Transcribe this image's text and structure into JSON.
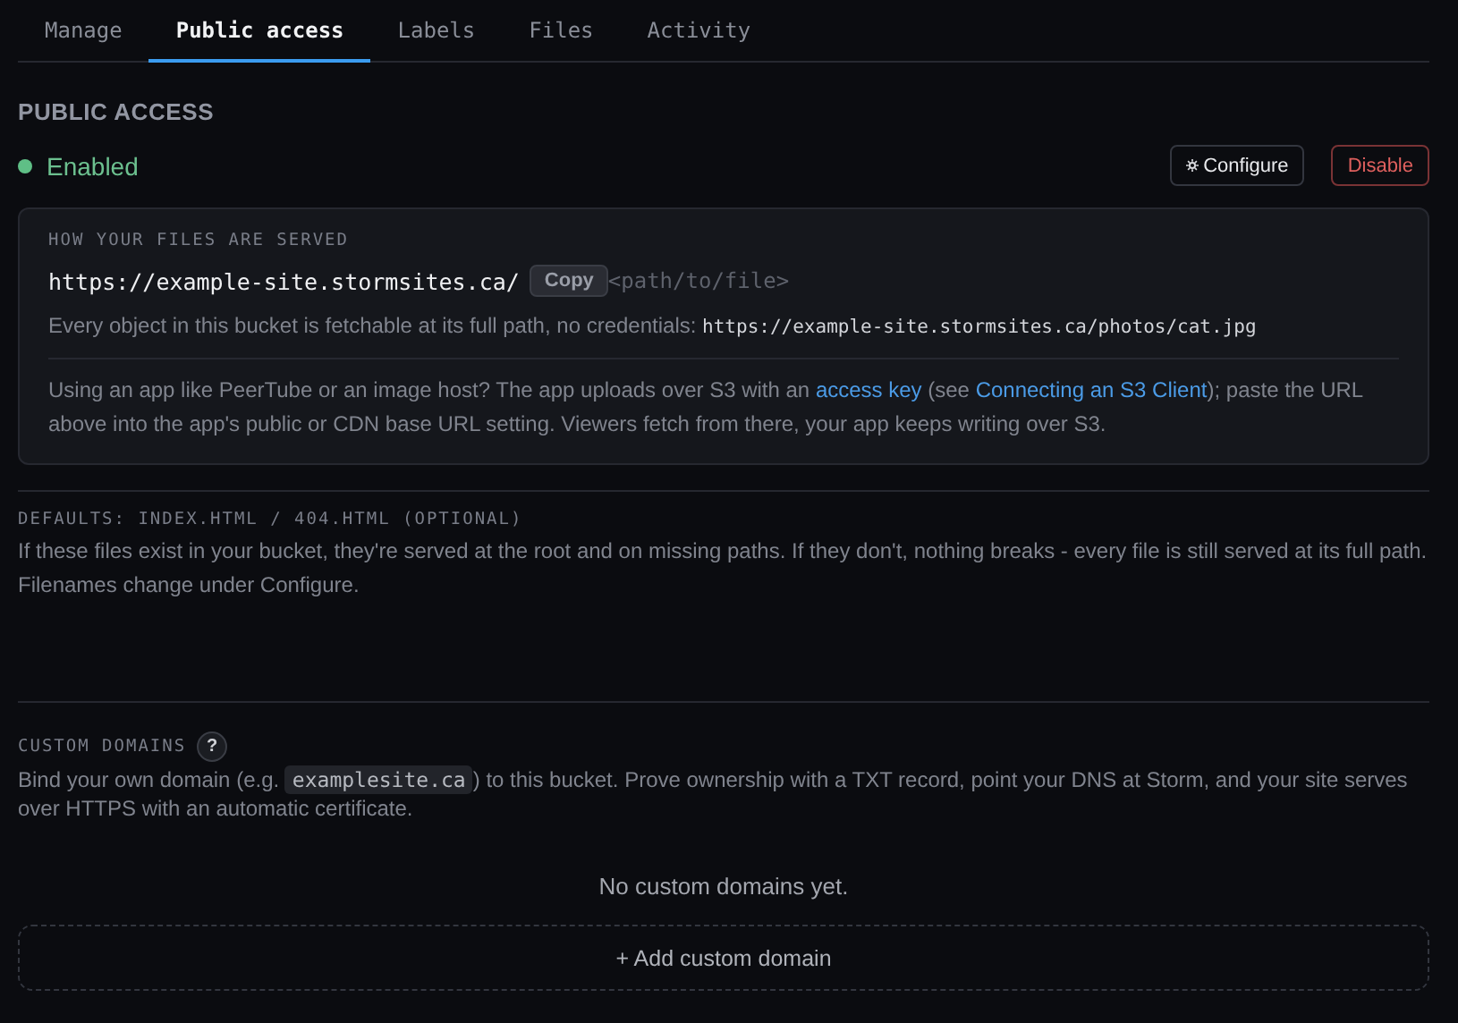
{
  "tabs": [
    {
      "label": "Manage",
      "selected": false
    },
    {
      "label": "Public access",
      "selected": true
    },
    {
      "label": "Labels",
      "selected": false
    },
    {
      "label": "Files",
      "selected": false
    },
    {
      "label": "Activity",
      "selected": false
    }
  ],
  "section_title": "PUBLIC ACCESS",
  "status": {
    "label": "Enabled",
    "on": true
  },
  "buttons": [
    {
      "label": "Configure",
      "kind": "configure"
    },
    {
      "label": "Disable",
      "kind": "danger"
    }
  ],
  "served_card": {
    "heading": "HOW YOUR FILES ARE SERVED",
    "base_url": "https://example-site.stormsites.ca/",
    "copy_button": "Copy",
    "path_hint": "<path/to/file>",
    "note": [
      {
        "kind": "text",
        "text": "Every object in this bucket is fetchable at its full path, no credentials: "
      },
      {
        "kind": "code",
        "text": "https://example-site.stormsites.ca/photos/cat.jpg"
      }
    ],
    "help": [
      {
        "kind": "text",
        "text": "Using an app like PeerTube or an image host? The app uploads over S3 with an "
      },
      {
        "kind": "link",
        "text": "access key"
      },
      {
        "kind": "text",
        "text": " (see "
      },
      {
        "kind": "link",
        "text": "Connecting an S3 Client"
      },
      {
        "kind": "text",
        "text": "); paste the URL above into the app's public or CDN base URL setting. Viewers fetch from there, your app keeps writing over S3."
      }
    ]
  },
  "defaults": {
    "heading": "DEFAULTS: INDEX.HTML / 404.HTML (OPTIONAL)",
    "text": [
      {
        "kind": "text",
        "text": "If these files exist in your bucket, they're served at the root and on missing paths. If they don't, nothing breaks - every file is still served at its full path. Filenames change under Configure."
      }
    ]
  },
  "custom_domains": {
    "heading": "CUSTOM DOMAINS",
    "help_badge": "?",
    "text": [
      {
        "kind": "text",
        "text": "Bind your own domain (e.g. "
      },
      {
        "kind": "chip",
        "text": "examplesite.ca"
      },
      {
        "kind": "text",
        "text": ") to this bucket. Prove ownership with a TXT record, point your DNS at Storm, and your site serves over HTTPS with an automatic certificate."
      }
    ],
    "empty_text": "No custom domains yet.",
    "add_button": "+ Add custom domain"
  }
}
